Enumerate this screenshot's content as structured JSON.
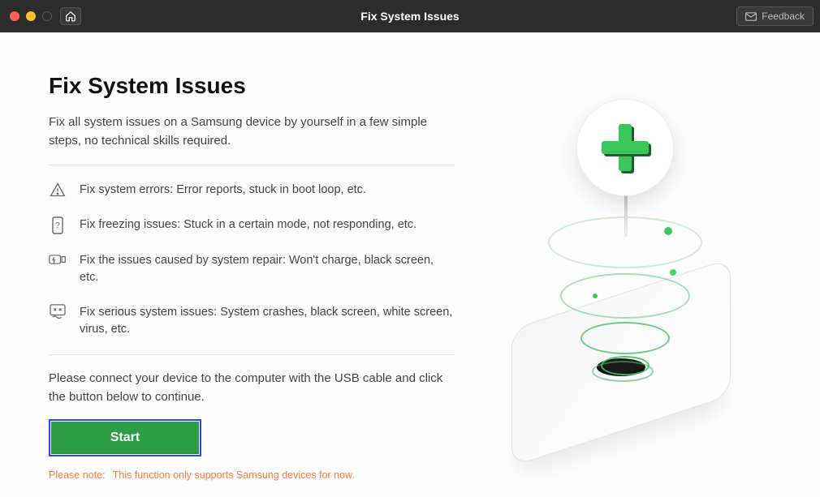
{
  "titlebar": {
    "title": "Fix System Issues",
    "feedback_label": "Feedback"
  },
  "main": {
    "heading": "Fix System Issues",
    "lead": "Fix all system issues on a Samsung device by yourself in a few simple steps, no technical skills required.",
    "features": [
      "Fix system errors: Error reports, stuck in boot loop, etc.",
      "Fix freezing issues: Stuck in a certain mode, not responding, etc.",
      "Fix the issues caused by system repair: Won't charge, black screen, etc.",
      "Fix serious system issues: System crashes, black screen, white screen, virus, etc."
    ],
    "instruction": "Please connect your device to the computer with the USB cable and click the button below to continue.",
    "start_label": "Start",
    "note_label": "Please note:",
    "note_text": "This function only supports Samsung devices for now."
  }
}
